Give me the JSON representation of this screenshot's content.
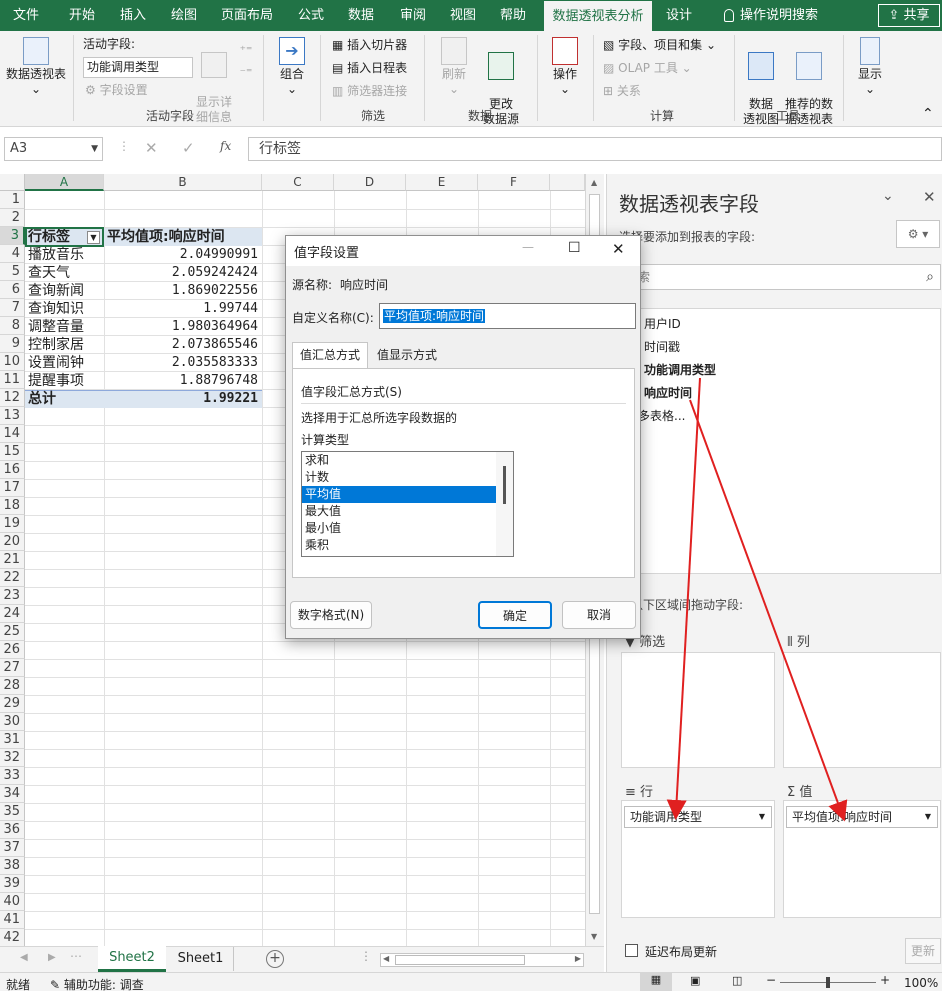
{
  "ribbon_tabs": [
    "文件",
    "开始",
    "插入",
    "绘图",
    "页面布局",
    "公式",
    "数据",
    "审阅",
    "视图",
    "帮助",
    "数据透视表分析",
    "设计",
    "操作说明搜索"
  ],
  "share_label": "共享",
  "ribbon": {
    "pivot_table": "数据透视表",
    "active_field_label": "活动字段:",
    "active_field_value": "功能调用类型",
    "field_settings": "字段设置",
    "expand_detail": "显示详\n细信息",
    "active_field_group": "活动字段",
    "group": "组合",
    "insert_slicer": "插入切片器",
    "insert_timeline": "插入日程表",
    "filter_connections": "筛选器连接",
    "filter_group": "筛选",
    "refresh": "刷新",
    "change_source": "更改\n数据源",
    "data_group": "数据",
    "actions": "操作",
    "fields_items_sets": "字段、项目和集",
    "olap_tools": "OLAP 工具",
    "relationships": "关系",
    "calc_group": "计算",
    "pivot_chart": "数据\n透视图",
    "recommended": "推荐的数\n据透视表",
    "tools_group": "工具",
    "show": "显示"
  },
  "formula_bar": {
    "name_box": "A3",
    "formula": "行标签"
  },
  "columns": [
    "A",
    "B",
    "C",
    "D",
    "E",
    "F"
  ],
  "rows": [
    "1",
    "2",
    "3",
    "4",
    "5",
    "6",
    "7",
    "8",
    "9",
    "10",
    "11",
    "12",
    "13",
    "14",
    "15",
    "16",
    "17",
    "18",
    "19",
    "20",
    "21",
    "22",
    "23",
    "24",
    "25",
    "26",
    "27",
    "28",
    "29",
    "30",
    "31",
    "32",
    "33",
    "34",
    "35",
    "36",
    "37",
    "38",
    "39",
    "40",
    "41",
    "42"
  ],
  "pivot": {
    "header_label": "行标签",
    "header_value": "平均值项:响应时间",
    "rows": [
      {
        "label": "播放音乐",
        "value": "2.04990991"
      },
      {
        "label": "查天气",
        "value": "2.059242424"
      },
      {
        "label": "查询新闻",
        "value": "1.869022556"
      },
      {
        "label": "查询知识",
        "value": "1.99744"
      },
      {
        "label": "调整音量",
        "value": "1.980364964"
      },
      {
        "label": "控制家居",
        "value": "2.073865546"
      },
      {
        "label": "设置闹钟",
        "value": "2.035583333"
      },
      {
        "label": "提醒事项",
        "value": "1.88796748"
      }
    ],
    "total_label": "总计",
    "total_value": "1.99221"
  },
  "sheets": [
    "Sheet2",
    "Sheet1"
  ],
  "status": {
    "ready": "就绪",
    "accessibility": "辅助功能: 调查",
    "zoom": "100%"
  },
  "pane": {
    "title": "数据透视表字段",
    "choose_label": "选择要添加到报表的字段:",
    "search_placeholder": "搜索",
    "fields": [
      "用户ID",
      "时间戳",
      "功能调用类型",
      "响应时间",
      "更多表格..."
    ],
    "drag_label": "在以下区域间拖动字段:",
    "filters": "筛选",
    "columns_zone": "列",
    "rows_zone": "行",
    "values_zone": "值",
    "row_item": "功能调用类型",
    "value_item": "平均值项:响应时间",
    "defer": "延迟布局更新",
    "update": "更新"
  },
  "dialog": {
    "title": "值字段设置",
    "source_label": "源名称:",
    "source_value": "响应时间",
    "custom_label": "自定义名称(C):",
    "custom_value": "平均值项:响应时间",
    "tab1": "值汇总方式",
    "tab2": "值显示方式",
    "summarize_label": "值字段汇总方式(S)",
    "desc": "选择用于汇总所选字段数据的",
    "calc_type": "计算类型",
    "options": [
      "求和",
      "计数",
      "平均值",
      "最大值",
      "最小值",
      "乘积"
    ],
    "selected": "平均值",
    "number_format": "数字格式(N)",
    "ok": "确定",
    "cancel": "取消"
  }
}
